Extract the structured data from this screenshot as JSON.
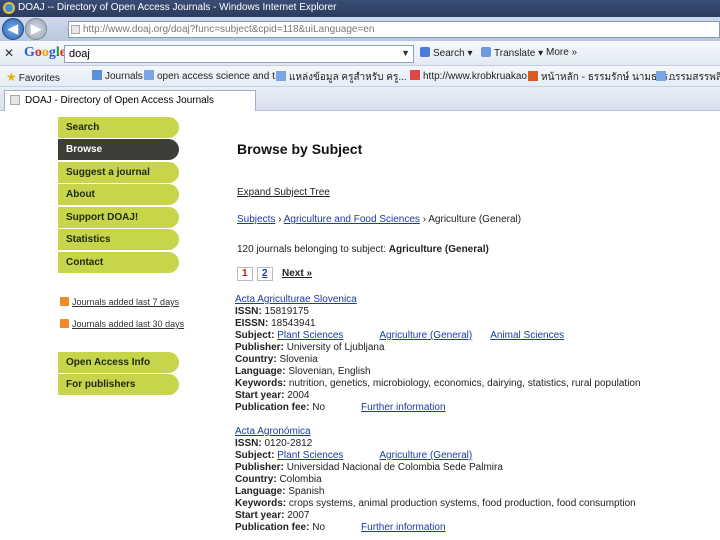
{
  "window": {
    "title": "DOAJ -- Directory of Open Access Journals - Windows Internet Explorer"
  },
  "address": {
    "url": "http://www.doaj.org/doaj?func=subject&cpid=118&uiLanguage=en"
  },
  "google_toolbar": {
    "search_value": "doaj",
    "search_button": "Search",
    "translate_button": "Translate",
    "more_button": "More »"
  },
  "favorites": {
    "label": "Favorites",
    "items": [
      "Journals",
      "open access science and t...",
      "แหล่งข้อมูล ครูสำหรับ ครู...",
      "http://www.krobkruakao",
      "หน้าหลัก - ธรรมรักษ์ นามธรร...",
      "กรรมสรรพสิ..."
    ]
  },
  "tab": {
    "label": "DOAJ - Directory of Open Access Journals"
  },
  "menu": {
    "items": [
      {
        "label": "Search",
        "active": false
      },
      {
        "label": "Browse",
        "active": true
      },
      {
        "label": "Suggest a journal",
        "active": false
      },
      {
        "label": "About",
        "active": false
      },
      {
        "label": "Support DOAJ!",
        "active": false
      },
      {
        "label": "Statistics",
        "active": false
      },
      {
        "label": "Contact",
        "active": false
      }
    ],
    "rss": [
      "Journals added last 7 days",
      "Journals added last 30 days"
    ],
    "bottom": [
      "Open Access Info",
      "For publishers"
    ]
  },
  "main": {
    "heading": "Browse by Subject",
    "expand_link": "Expand Subject Tree",
    "breadcrumb": {
      "subjects": "Subjects",
      "sep1": "›",
      "agri_food": "Agriculture and Food Sciences",
      "sep2": "›",
      "current": "Agriculture (General)"
    },
    "count_text": "120 journals belonging to subject:",
    "count_subject": "Agriculture (General)",
    "pages": {
      "current": "1",
      "next_num": "2",
      "next": "Next »"
    }
  },
  "labels": {
    "issn": "ISSN:",
    "eissn": "EISSN:",
    "subject": "Subject:",
    "publisher": "Publisher:",
    "country": "Country:",
    "language": "Language:",
    "keywords": "Keywords:",
    "start_year": "Start year:",
    "fee": "Publication fee:",
    "further": "Further information"
  },
  "records": [
    {
      "title": "Acta Agriculturae Slovenica",
      "issn": "15819175",
      "eissn": "18543941",
      "subjects": [
        "Plant Sciences",
        "Agriculture (General)",
        "Animal Sciences"
      ],
      "publisher": "University of Ljubljana",
      "country": "Slovenia",
      "language": "Slovenian, English",
      "keywords": "nutrition, genetics, microbiology, economics, dairying, statistics, rural population",
      "start_year": "2004",
      "fee": "No"
    },
    {
      "title": "Acta Agronómica",
      "issn": "0120-2812",
      "subjects": [
        "Plant Sciences",
        "Agriculture (General)"
      ],
      "publisher": "Universidad Nacional de Colombia Sede Palmira",
      "country": "Colombia",
      "language": "Spanish",
      "keywords": "crops systems, animal production systems, food production, food consumption",
      "start_year": "2007",
      "fee": "No"
    }
  ],
  "colors": {
    "menu": "#c8d44a",
    "menu_active": "#3e3e38",
    "link": "#1a3aa8"
  }
}
